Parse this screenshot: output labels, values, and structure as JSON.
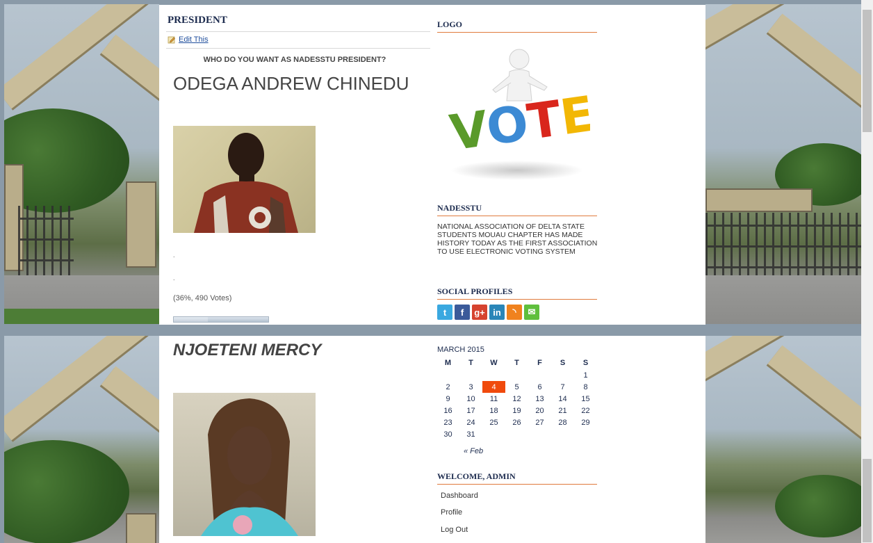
{
  "poll": {
    "heading": "PRESIDENT",
    "edit_label": "Edit This",
    "question": "WHO DO YOU WANT AS NADESSTU PRESIDENT?",
    "candidates": [
      {
        "name": "ODEGA ANDREW CHINEDU",
        "dot1": ".",
        "dot2": ".",
        "result": "(36%, 490 Votes)",
        "percent": 36
      },
      {
        "name": "NJOETENI MERCY"
      }
    ]
  },
  "sidebar": {
    "logo_title": "LOGO",
    "logo_word": "VOTE",
    "about_title": "NADESSTU",
    "about_text": "NATIONAL ASSOCIATION OF DELTA STATE STUDENTS MOUAU CHAPTER HAS MADE HISTORY TODAY AS THE FIRST ASSOCIATION TO USE ELECTRONIC VOTING SYSTEM",
    "social_title": "SOCIAL PROFILES",
    "social": [
      {
        "icon": "twitter-icon",
        "glyph": "t",
        "color": "#3aa8e0"
      },
      {
        "icon": "facebook-icon",
        "glyph": "f",
        "color": "#3b5a9a"
      },
      {
        "icon": "google-plus-icon",
        "glyph": "g+",
        "color": "#d6432f"
      },
      {
        "icon": "linkedin-icon",
        "glyph": "in",
        "color": "#2a86b8"
      },
      {
        "icon": "rss-icon",
        "glyph": "◝",
        "color": "#f0821e"
      },
      {
        "icon": "email-icon",
        "glyph": "✉",
        "color": "#5fbf3d"
      }
    ],
    "calendar": {
      "caption": "MARCH 2015",
      "weekdays": [
        "M",
        "T",
        "W",
        "T",
        "F",
        "S",
        "S"
      ],
      "weeks": [
        [
          "",
          "",
          "",
          "",
          "",
          "",
          "1"
        ],
        [
          "2",
          "3",
          "4",
          "5",
          "6",
          "7",
          "8"
        ],
        [
          "9",
          "10",
          "11",
          "12",
          "13",
          "14",
          "15"
        ],
        [
          "16",
          "17",
          "18",
          "19",
          "20",
          "21",
          "22"
        ],
        [
          "23",
          "24",
          "25",
          "26",
          "27",
          "28",
          "29"
        ],
        [
          "30",
          "31",
          "",
          "",
          "",
          "",
          ""
        ]
      ],
      "today": "4",
      "prev_label": "« Feb"
    },
    "welcome_title": "WELCOME, ADMIN",
    "admin_links": [
      "Dashboard",
      "Profile",
      "Log Out"
    ]
  },
  "colors": {
    "heading": "#1c2b4e",
    "accent_rule": "#e07a3c",
    "today": "#f04a0c",
    "link": "#1f4e9c"
  }
}
